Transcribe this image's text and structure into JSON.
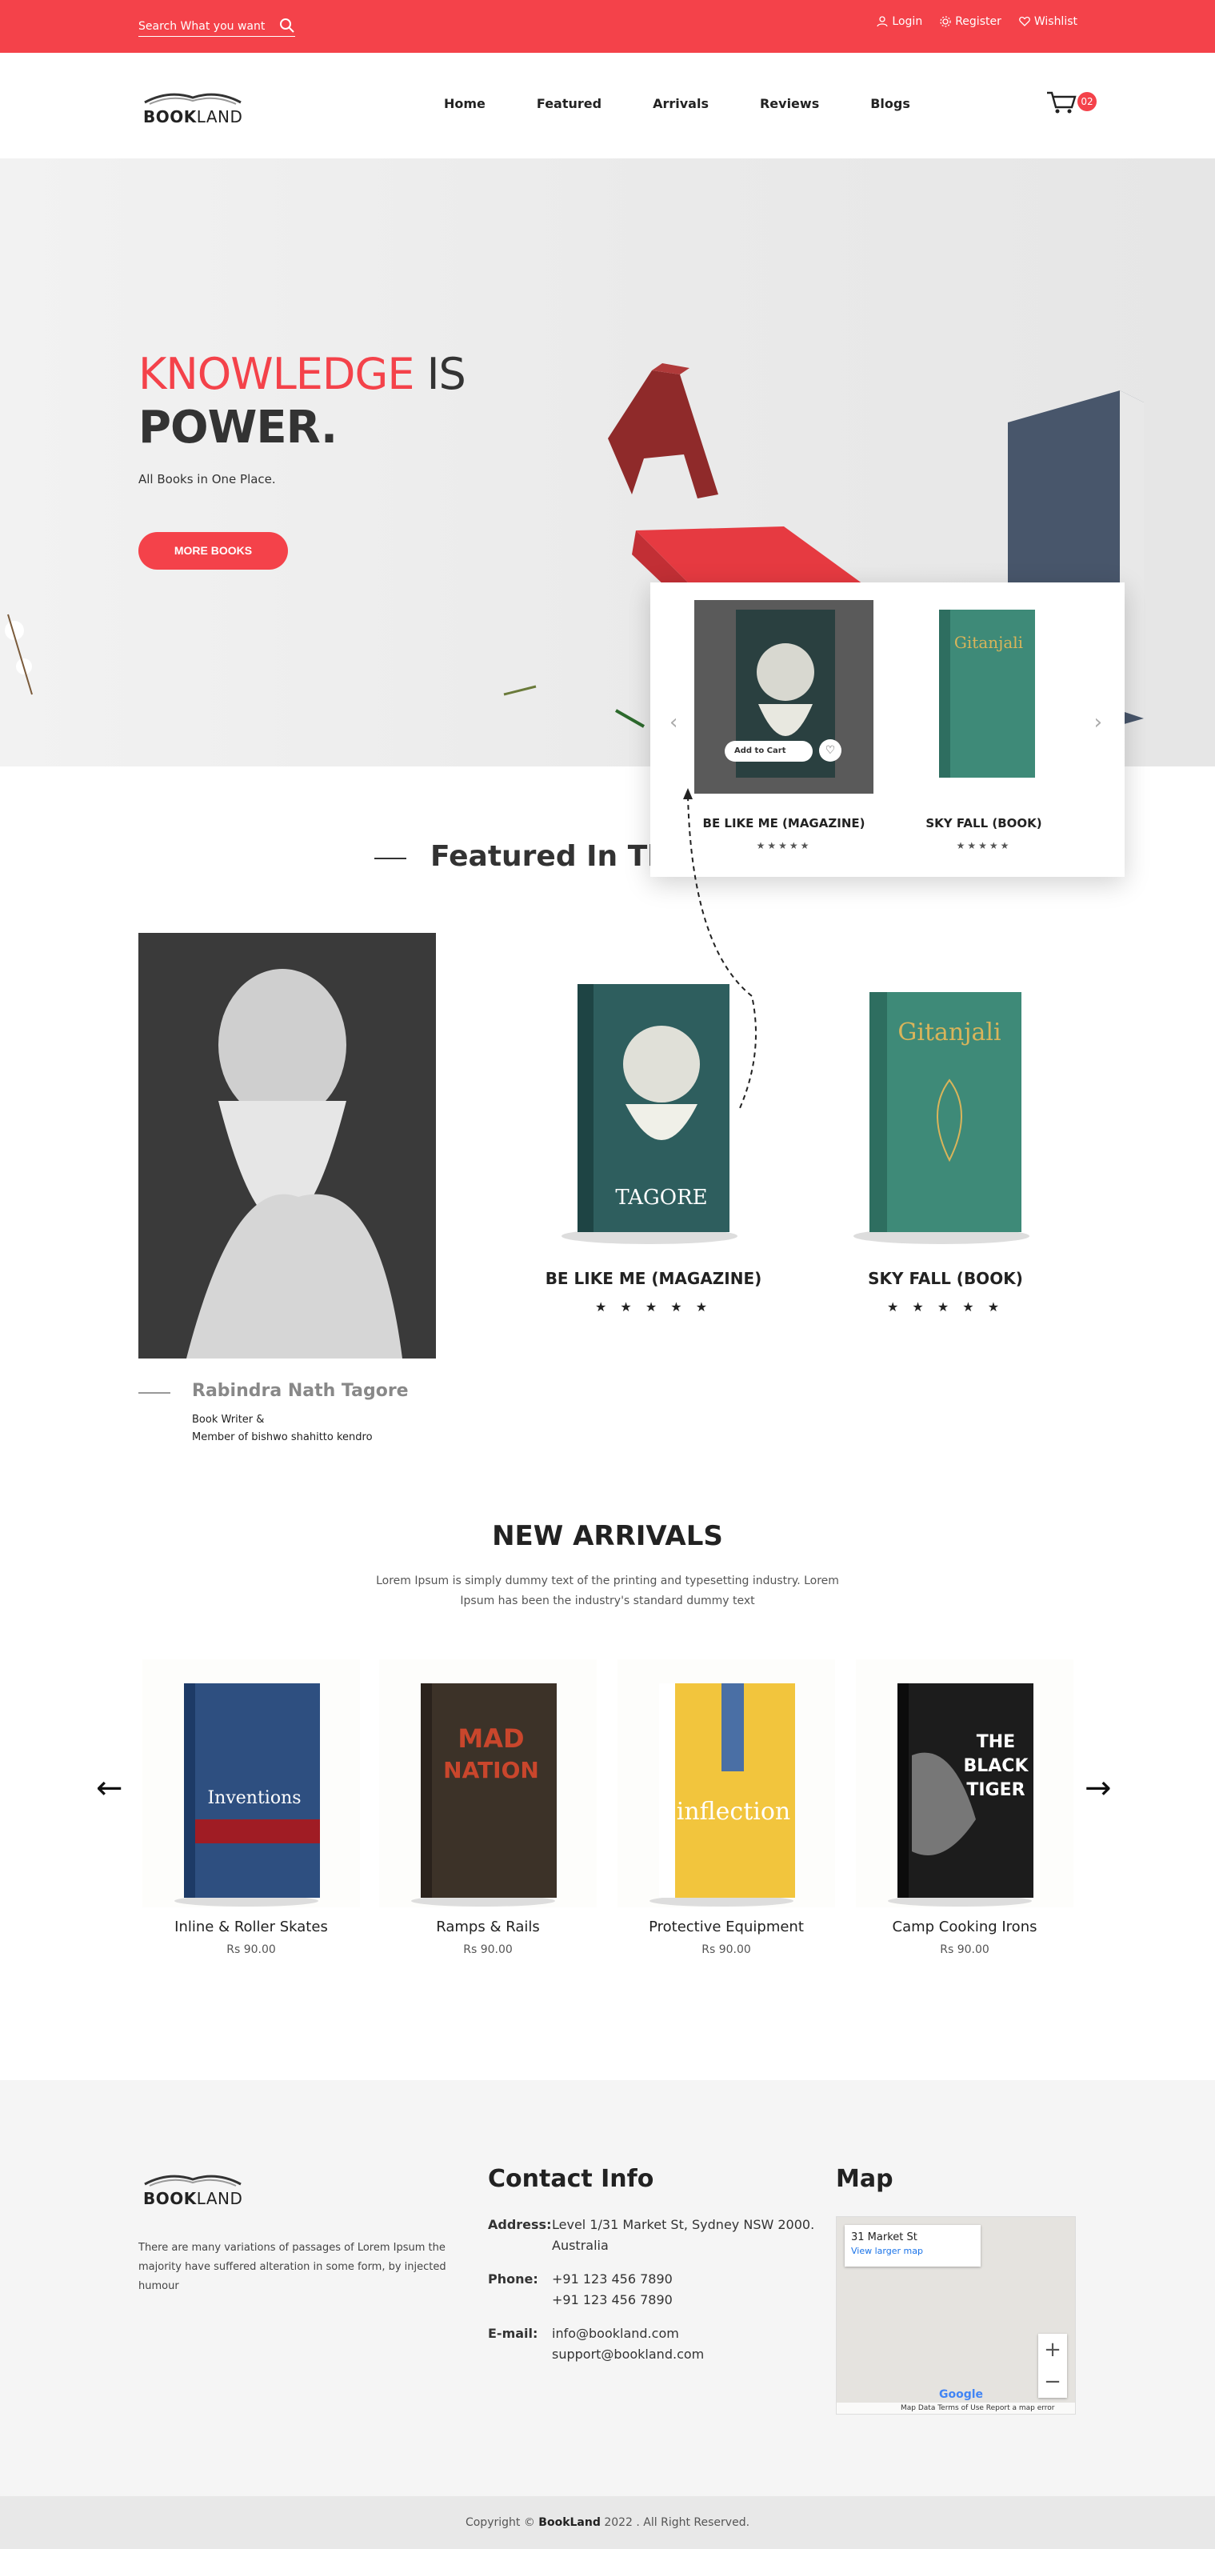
{
  "topbar": {
    "search_placeholder": "Search What you want",
    "login": "Login",
    "register": "Register",
    "wishlist": "Wishlist"
  },
  "header": {
    "logo_bold": "BOOK",
    "logo_light": "LAND",
    "nav": [
      "Home",
      "Featured",
      "Arrivals",
      "Reviews",
      "Blogs"
    ],
    "cart_count": "02"
  },
  "hero": {
    "title_red": "KNOWLEDGE",
    "title_dark": "IS",
    "title_line2": "POWER.",
    "subtitle": "All Books in One Place.",
    "button": "MORE BOOKS"
  },
  "popup": {
    "add_to_cart": "Add to Cart",
    "items": [
      {
        "title": "BE LIKE ME (MAGAZINE)",
        "stars": "★★★★★"
      },
      {
        "title": "SKY FALL (BOOK)",
        "stars": "★★★★★"
      }
    ]
  },
  "featured": {
    "heading": "Featured In Th",
    "author_name": "Rabindra Nath Tagore",
    "author_line1": "Book Writer &",
    "author_line2": "Member of bishwo shahitto kendro",
    "books": [
      {
        "title": "BE LIKE ME (MAGAZINE)",
        "stars": "★ ★ ★ ★ ★"
      },
      {
        "title": "SKY FALL (BOOK)",
        "stars": "★ ★ ★ ★ ★"
      }
    ]
  },
  "arrivals": {
    "heading": "NEW ARRIVALS",
    "description": "Lorem Ipsum is simply dummy text of the printing and typesetting industry. Lorem Ipsum has been the industry's standard dummy text",
    "prev": "←",
    "next": "→",
    "items": [
      {
        "name": "Inline & Roller Skates",
        "price": "Rs 90.00"
      },
      {
        "name": "Ramps & Rails",
        "price": "Rs 90.00"
      },
      {
        "name": "Protective Equipment",
        "price": "Rs 90.00"
      },
      {
        "name": "Camp Cooking Irons",
        "price": "Rs 90.00"
      }
    ]
  },
  "footer": {
    "about": "There are many variations of passages of Lorem Ipsum the majority have suffered alteration in some form, by injected humour",
    "contact_heading": "Contact Info",
    "address_label": "Address:",
    "address_1": "Level 1/31 Market St, Sydney NSW 2000.",
    "address_2": "Australia",
    "phone_label": "Phone:",
    "phone_1": "+91 123 456 7890",
    "phone_2": "+91 123 456 7890",
    "email_label": "E-mail:",
    "email_1": "info@bookland.com",
    "email_2": "support@bookland.com",
    "map_heading": "Map",
    "map_place": "31 Market St",
    "map_link": "View larger map",
    "map_footer": "Map Data    Terms of Use    Report a map error",
    "map_google": "Google",
    "copyright_pre": "Copyright ©",
    "copyright_brand": "BookLand",
    "copyright_post": "2022 . All Right Reserved."
  },
  "colors": {
    "accent": "#f4424a",
    "footer_bg": "#f5f5f5"
  }
}
